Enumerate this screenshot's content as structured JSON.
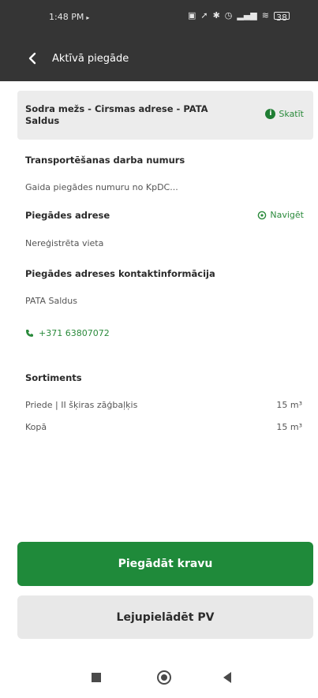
{
  "status_bar": {
    "time": "1:48 PM",
    "play_glyph": "▸",
    "icons": [
      "sim-icon",
      "location-icon",
      "bluetooth-icon",
      "alarm-icon",
      "signal-icon",
      "wifi-icon"
    ],
    "battery": "38"
  },
  "app_bar": {
    "title": "Aktīvā piegāde"
  },
  "header": {
    "title": "Sodra mežs - Cirsmas adrese - PATA Saldus",
    "view_label": "Skatīt"
  },
  "transport": {
    "label": "Transportēšanas darba numurs",
    "value": "Gaida piegādes numuru no KpDC..."
  },
  "delivery_address": {
    "label": "Piegādes adrese",
    "navigate_label": "Navigēt",
    "value": "Nereģistrēta vieta"
  },
  "contact": {
    "label": "Piegādes adreses kontaktinformācija",
    "name": "PATA Saldus",
    "phone": "+371 63807072"
  },
  "assortment": {
    "label": "Sortiments",
    "rows": [
      {
        "name": "Priede | II šķiras zāģbaļķis",
        "amount": "15 m³"
      },
      {
        "name": "Kopā",
        "amount": "15 m³"
      }
    ]
  },
  "buttons": {
    "deliver": "Piegādāt kravu",
    "download": "Lejupielādēt PV"
  },
  "colors": {
    "accent": "#1f8a3a",
    "topbar": "#353535"
  }
}
